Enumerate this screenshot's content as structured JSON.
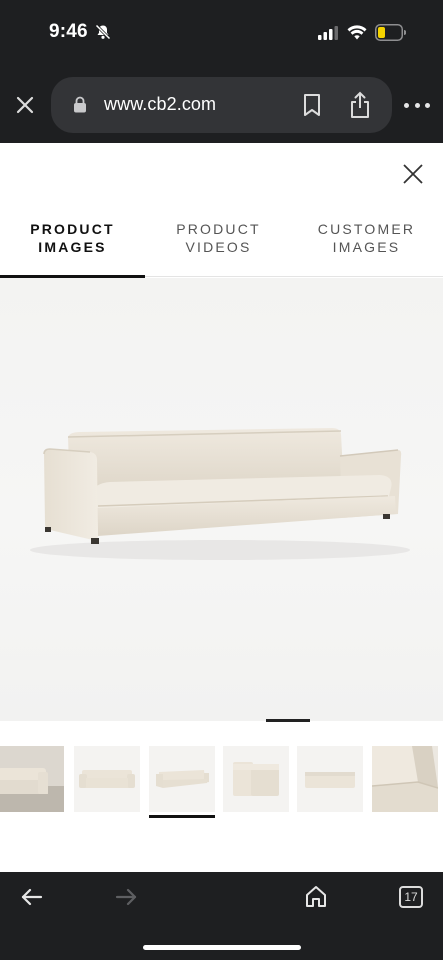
{
  "status_bar": {
    "time": "9:46",
    "icons": [
      "bell-off-icon",
      "signal-icon",
      "wifi-icon",
      "battery-icon"
    ],
    "battery_color": "#f5d300"
  },
  "browser": {
    "url": "www.cb2.com",
    "tab_count": "17",
    "icons": [
      "close-icon",
      "lock-icon",
      "bookmark-icon",
      "share-icon",
      "more-icon",
      "back-icon",
      "forward-icon",
      "home-icon"
    ]
  },
  "gallery": {
    "tabs": [
      {
        "label": "PRODUCT IMAGES",
        "active": true
      },
      {
        "label": "PRODUCT VIDEOS",
        "active": false
      },
      {
        "label": "CUSTOMER IMAGES",
        "active": false
      }
    ],
    "thumbnails": [
      {
        "name": "sofa-in-room"
      },
      {
        "name": "sofa-front"
      },
      {
        "name": "sofa-angle",
        "selected": true
      },
      {
        "name": "sofa-side"
      },
      {
        "name": "sofa-back"
      },
      {
        "name": "sofa-detail"
      }
    ]
  },
  "colors": {
    "chrome_bg": "#1e1f21",
    "url_bar_bg": "#333437",
    "sofa_fabric": "#e9e2d6",
    "active_tab": "#111111"
  }
}
